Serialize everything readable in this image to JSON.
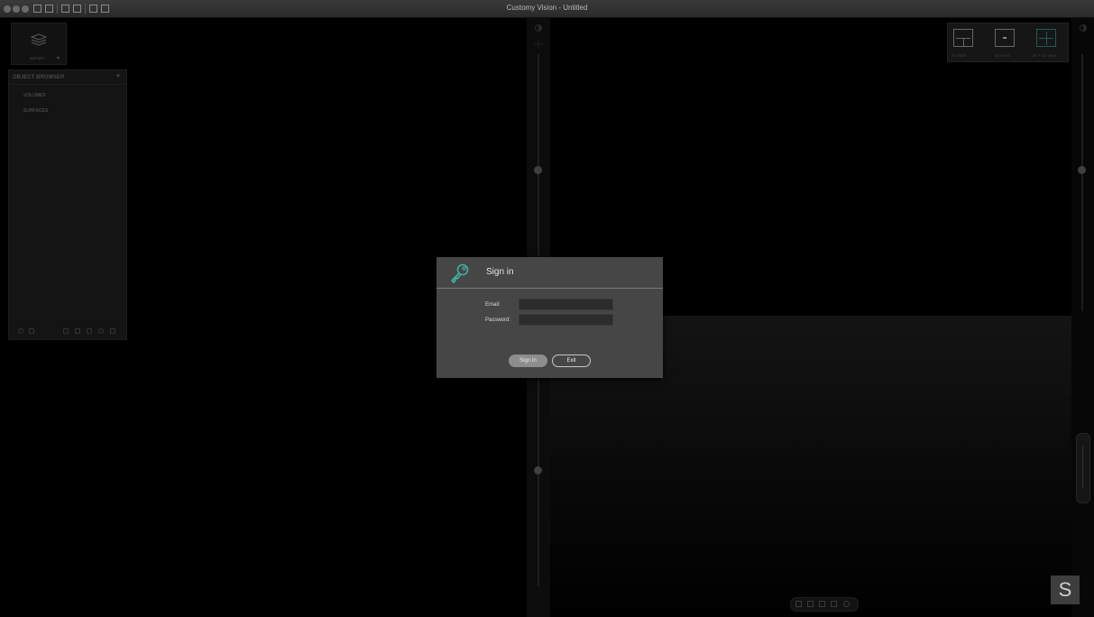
{
  "window": {
    "title": "Customy Vision - Untitled"
  },
  "import_widget": {
    "label": "IMPORT"
  },
  "object_browser": {
    "title": "OBJECT BROWSER",
    "items": [
      {
        "label": "VOLUMES"
      },
      {
        "label": "SURFACES"
      }
    ]
  },
  "view_controls": [
    {
      "label": "2D VIEW",
      "icon": "quad-view-icon"
    },
    {
      "label": "3D VIEW",
      "icon": "single-view-icon"
    },
    {
      "label": "3D + 2D VIEW",
      "icon": "combined-view-icon"
    }
  ],
  "logo": {
    "letter": "S"
  },
  "dialog": {
    "title": "Sign in",
    "icon": "key-icon",
    "accent_color": "#3fb0a3",
    "email_label": "Email:",
    "email_value": "",
    "password_label": "Password:",
    "password_value": "",
    "signin_label": "Sign In",
    "exit_label": "Exit"
  }
}
